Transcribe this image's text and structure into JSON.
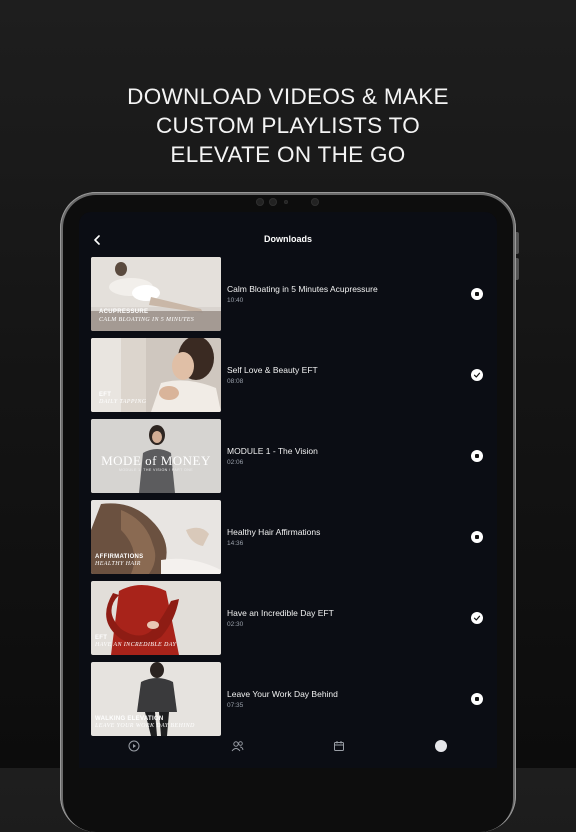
{
  "promo": {
    "line1": "DOWNLOAD VIDEOS & MAKE",
    "line2": "CUSTOM PLAYLISTS TO",
    "line3": "ELEVATE ON THE GO"
  },
  "screen": {
    "title": "Downloads",
    "back_icon": "chevron-left-icon"
  },
  "downloads": [
    {
      "title": "Calm Bloating in 5 Minutes Acupressure",
      "duration": "10:40",
      "status": "downloading",
      "thumb_caption1": "ACUPRESSURE",
      "thumb_caption2": "CALM BLOATING IN 5 MINUTES"
    },
    {
      "title": "Self Love & Beauty EFT",
      "duration": "08:08",
      "status": "downloaded",
      "thumb_caption1": "EFT",
      "thumb_caption2": "DAILY TAPPING"
    },
    {
      "title": "MODULE 1 - The Vision",
      "duration": "02:06",
      "status": "downloading",
      "thumb_big": "MODE of MONEY",
      "thumb_sub": "MODULE 1: THE VISION / PART ONE"
    },
    {
      "title": "Healthy Hair Affirmations",
      "duration": "14:36",
      "status": "downloading",
      "thumb_caption1": "AFFIRMATIONS",
      "thumb_caption2": "HEALTHY HAIR"
    },
    {
      "title": "Have an Incredible Day EFT",
      "duration": "02:30",
      "status": "downloaded",
      "thumb_caption1": "EFT",
      "thumb_caption2": "HAVE AN INCREDIBLE DAY"
    },
    {
      "title": "Leave Your Work Day Behind",
      "duration": "07:35",
      "status": "downloading",
      "thumb_caption1": "WALKING ELEVATION",
      "thumb_caption2": "LEAVE YOUR WORK DAY BEHIND"
    }
  ],
  "tabbar": {
    "items": [
      "play-circle-icon",
      "people-icon",
      "calendar-icon",
      "profile-avatar"
    ]
  },
  "colors": {
    "screen_bg": "#0b0d14",
    "text_primary": "#f2f2f2",
    "text_secondary": "#9aa0aa"
  }
}
